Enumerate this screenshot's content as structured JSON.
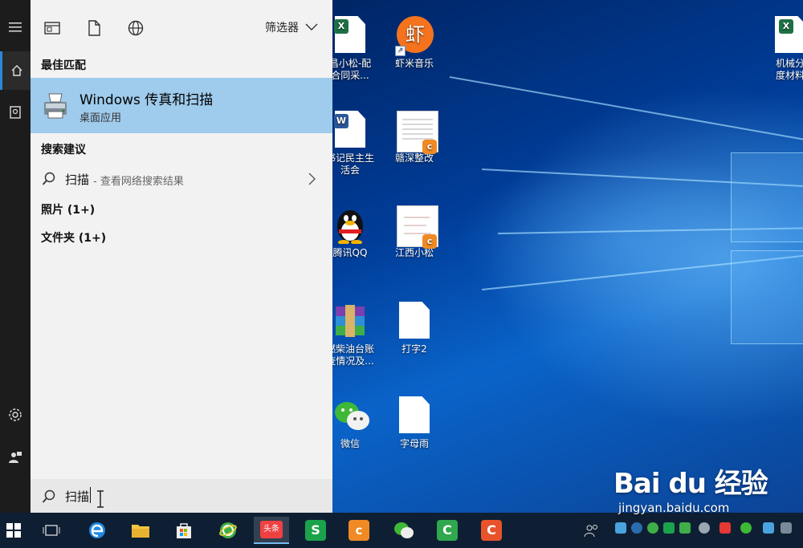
{
  "start_menu": {
    "filter_label": "筛选器",
    "best_match_header": "最佳匹配",
    "best_match": {
      "title": "Windows 传真和扫描",
      "subtitle": "桌面应用"
    },
    "suggestions_header": "搜索建议",
    "suggestion": {
      "term": "扫描",
      "detail": " - 查看网络搜索结果"
    },
    "photos_label": "照片 (1+)",
    "folders_label": "文件夹 (1+)",
    "search_value": "扫描"
  },
  "desktop": {
    "icons": [
      {
        "label": "昌小松-配\n合同采...",
        "name": "xiaosong-contract-excel"
      },
      {
        "label": "虾米音乐",
        "name": "xiami-music"
      },
      {
        "label": "书记民主生\n活会",
        "name": "meeting-word-doc"
      },
      {
        "label": "赣深整改",
        "name": "gan-shen-rectify"
      },
      {
        "label": "腾讯QQ",
        "name": "tencent-qq"
      },
      {
        "label": "江西小松",
        "name": "jiangxi-xiaosong"
      },
      {
        "label": "燃柴油台账\n查情况及...",
        "name": "diesel-ledger-archive"
      },
      {
        "label": "打字2",
        "name": "typing-2"
      },
      {
        "label": "微信",
        "name": "wechat"
      },
      {
        "label": "字母雨",
        "name": "letter-rain"
      },
      {
        "label": "机械分\n度材料",
        "name": "machinery-materials"
      }
    ],
    "xiami_glyph": "虾"
  },
  "taskbar": {
    "news_label": "头条"
  },
  "watermark": {
    "logo": "Bai du 经验",
    "url": "jingyan.baidu.com"
  },
  "colors": {
    "accent": "#2b88d8",
    "best_match_bg": "#9fcbec",
    "taskbar": "#0f1f33"
  }
}
